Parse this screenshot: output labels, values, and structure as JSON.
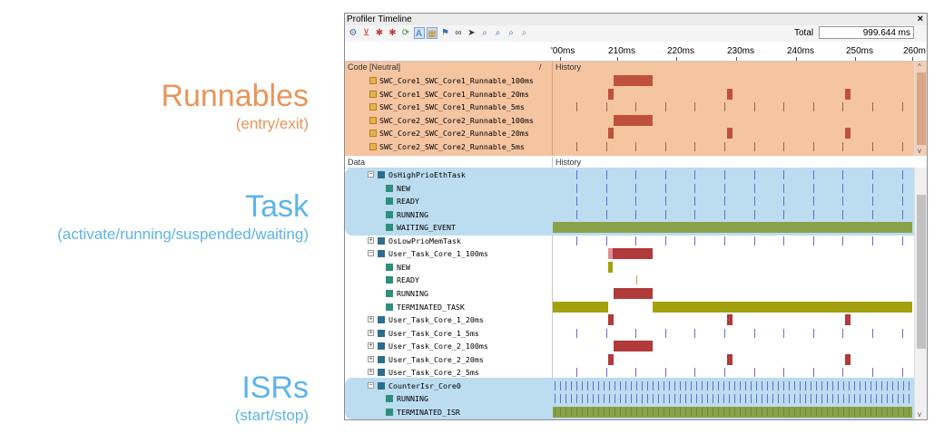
{
  "callouts": {
    "runnables": {
      "title": "Runnables",
      "subtitle": "(entry/exit)"
    },
    "task": {
      "title": "Task",
      "subtitle": "(activate/running/suspended/waiting)"
    },
    "isrs": {
      "title": "ISRs",
      "subtitle": "(start/stop)"
    }
  },
  "window": {
    "title": "Profiler Timeline",
    "close": "×",
    "total_label": "Total",
    "total_value": "999.644 ms"
  },
  "toolbar_icons": [
    "gear-icon",
    "filter-icon",
    "bug-icon",
    "bug-add-icon",
    "export-icon",
    "toggle-a-icon",
    "toggle-b-icon",
    "marker-icon",
    "binoculars-icon",
    "goto-icon",
    "zoom-in-icon",
    "zoom-out-icon",
    "zoom-fit-icon",
    "zoom-reset-icon"
  ],
  "ruler": {
    "ticks": [
      "'00ms",
      "210ms",
      "220ms",
      "230ms",
      "240ms",
      "250ms",
      "260m"
    ]
  },
  "code_panel": {
    "col1": "Code [Neutral]",
    "slash": "/",
    "col2": "History",
    "rows": [
      {
        "label": "SWC_Core1_SWC_Core1_Runnable_100ms"
      },
      {
        "label": "SWC_Core1_SWC_Core1_Runnable_20ms"
      },
      {
        "label": "SWC_Core1_SWC_Core1_Runnable_5ms"
      },
      {
        "label": "SWC_Core2_SWC_Core2_Runnable_100ms"
      },
      {
        "label": "SWC_Core2_SWC_Core2_Runnable_20ms"
      },
      {
        "label": "SWC_Core2_SWC_Core2_Runnable_5ms"
      }
    ]
  },
  "data_panel": {
    "col1": "Data",
    "col2": "History",
    "rows": [
      {
        "label": "OsHighPrioEthTask",
        "kind": "task",
        "expander": "−"
      },
      {
        "label": "NEW",
        "kind": "state"
      },
      {
        "label": "READY",
        "kind": "state"
      },
      {
        "label": "RUNNING",
        "kind": "state"
      },
      {
        "label": "WAITING_EVENT",
        "kind": "state"
      },
      {
        "label": "OsLowPrioMemTask",
        "kind": "task",
        "expander": "+"
      },
      {
        "label": "User_Task_Core_1_100ms",
        "kind": "task",
        "expander": "−"
      },
      {
        "label": "NEW",
        "kind": "state"
      },
      {
        "label": "READY",
        "kind": "state"
      },
      {
        "label": "RUNNING",
        "kind": "state"
      },
      {
        "label": "TERMINATED_TASK",
        "kind": "state"
      },
      {
        "label": "User_Task_Core_1_20ms",
        "kind": "task",
        "expander": "+"
      },
      {
        "label": "User_Task_Core_1_5ms",
        "kind": "task",
        "expander": "+"
      },
      {
        "label": "User_Task_Core_2_100ms",
        "kind": "task",
        "expander": "+"
      },
      {
        "label": "User_Task_Core_2_20ms",
        "kind": "task",
        "expander": "+"
      },
      {
        "label": "User_Task_Core_2_5ms",
        "kind": "task",
        "expander": "+"
      },
      {
        "label": "CounterIsr_Core0",
        "kind": "task",
        "expander": "−"
      },
      {
        "label": "RUNNING",
        "kind": "state"
      },
      {
        "label": "TERMINATED_ISR",
        "kind": "state"
      }
    ]
  },
  "colors": {
    "runnables_highlight": "#f5c4a1",
    "task_highlight": "#bcdcf0",
    "bar_red": "#b13a3a",
    "bar_green": "#8aa14a",
    "bar_olive": "#a3a20e",
    "mark_blue": "#6a6ad0"
  }
}
